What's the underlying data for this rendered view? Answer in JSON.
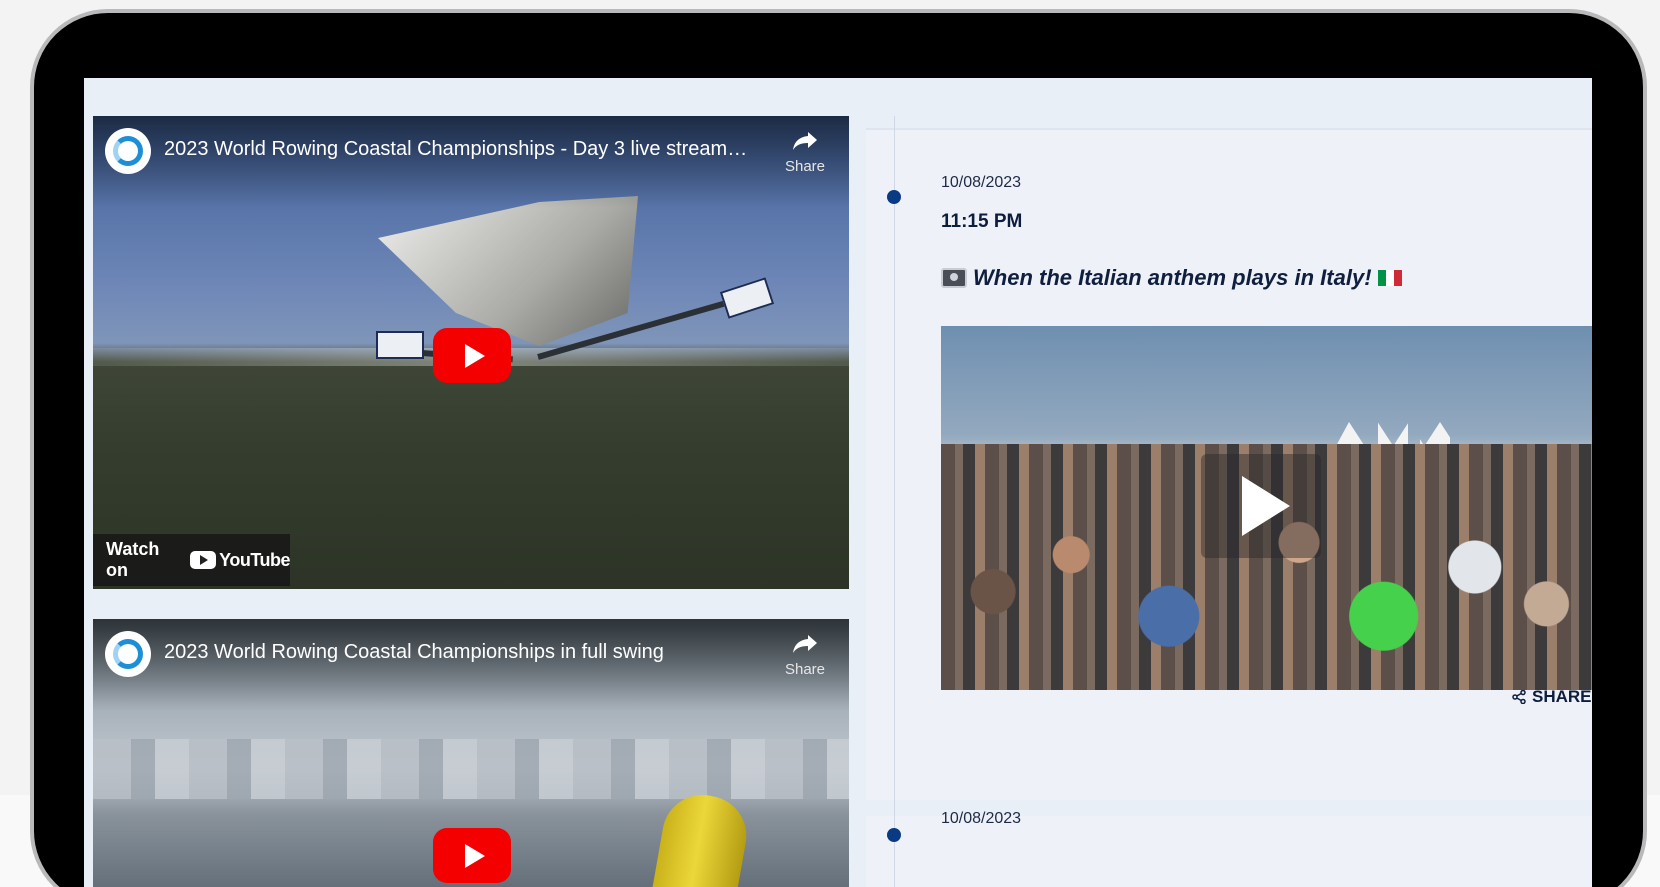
{
  "videos": [
    {
      "title": "2023 World Rowing Coastal Championships - Day 3 live stream…",
      "share_label": "Share",
      "watch_on_label": "Watch on",
      "platform_label": "YouTube"
    },
    {
      "title": "2023 World Rowing Coastal Championships in full swing",
      "share_label": "Share"
    }
  ],
  "posts": [
    {
      "date": "10/08/2023",
      "time": "11:15 PM",
      "headline": "When the Italian anthem plays in Italy!",
      "headline_icon": "video-camera-icon",
      "flag_icon": "italy-flag-icon",
      "share_label": "SHARE"
    },
    {
      "date": "10/08/2023"
    }
  ],
  "colors": {
    "youtube_red": "#f40000",
    "timeline_dot": "#0b3a84",
    "headline_text": "#0f1f3d",
    "feed_background": "#eef2f8",
    "flag_green": "#009246",
    "flag_white": "#ffffff",
    "flag_red": "#ce2b37"
  }
}
